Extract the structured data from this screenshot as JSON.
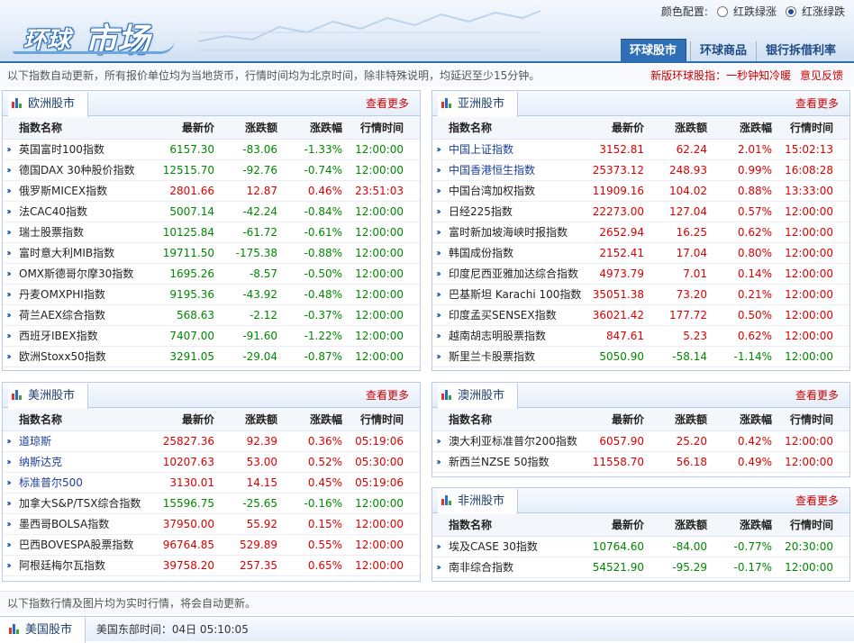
{
  "header": {
    "logo_part1": "环球",
    "logo_part2": "市场",
    "color_config_label": "颜色配置:",
    "option_red_down": "红跌绿涨",
    "option_red_up": "红涨绿跌",
    "tabs": [
      {
        "label": "环球股市",
        "active": true
      },
      {
        "label": "环球商品",
        "active": false
      },
      {
        "label": "银行拆借利率",
        "active": false
      }
    ]
  },
  "notice": {
    "text": "以下指数自动更新，所有报价单位均为当地货币，行情时间均为北京时间，除非特殊说明，均延迟至少15分钟。",
    "link1": "新版环球股指：一秒钟知冷暖",
    "link2": "意见反馈"
  },
  "columns": [
    "指数名称",
    "最新价",
    "涨跌额",
    "涨跌幅",
    "行情时间"
  ],
  "more_label": "查看更多",
  "panels": {
    "europe": {
      "title": "欧洲股市",
      "rows": [
        {
          "name": "英国富时100指数",
          "price": "6157.30",
          "chg": "-83.06",
          "pct": "-1.33%",
          "time": "12:00:00",
          "dir": "dn",
          "style": ""
        },
        {
          "name": "德国DAX 30种股价指数",
          "price": "12515.70",
          "chg": "-92.76",
          "pct": "-0.74%",
          "time": "12:00:00",
          "dir": "dn",
          "style": ""
        },
        {
          "name": "俄罗斯MICEX指数",
          "price": "2801.66",
          "chg": "12.87",
          "pct": "0.46%",
          "time": "23:51:03",
          "dir": "up",
          "style": ""
        },
        {
          "name": "法CAC40指数",
          "price": "5007.14",
          "chg": "-42.24",
          "pct": "-0.84%",
          "time": "12:00:00",
          "dir": "dn",
          "style": ""
        },
        {
          "name": "瑞士股票指数",
          "price": "10125.84",
          "chg": "-61.72",
          "pct": "-0.61%",
          "time": "12:00:00",
          "dir": "dn",
          "style": ""
        },
        {
          "name": "富时意大利MIB指数",
          "price": "19711.50",
          "chg": "-175.38",
          "pct": "-0.88%",
          "time": "12:00:00",
          "dir": "dn",
          "style": ""
        },
        {
          "name": "OMX斯德哥尔摩30指数",
          "price": "1695.26",
          "chg": "-8.57",
          "pct": "-0.50%",
          "time": "12:00:00",
          "dir": "dn",
          "style": ""
        },
        {
          "name": "丹麦OMXPHI指数",
          "price": "9195.36",
          "chg": "-43.92",
          "pct": "-0.48%",
          "time": "12:00:00",
          "dir": "dn",
          "style": ""
        },
        {
          "name": "荷兰AEX综合指数",
          "price": "568.63",
          "chg": "-2.12",
          "pct": "-0.37%",
          "time": "12:00:00",
          "dir": "dn",
          "style": ""
        },
        {
          "name": "西班牙IBEX指数",
          "price": "7407.00",
          "chg": "-91.60",
          "pct": "-1.22%",
          "time": "12:00:00",
          "dir": "dn",
          "style": ""
        },
        {
          "name": "欧洲Stoxx50指数",
          "price": "3291.05",
          "chg": "-29.04",
          "pct": "-0.87%",
          "time": "12:00:00",
          "dir": "dn",
          "style": ""
        }
      ]
    },
    "asia": {
      "title": "亚洲股市",
      "rows": [
        {
          "name": "中国上证指数",
          "price": "3152.81",
          "chg": "62.24",
          "pct": "2.01%",
          "time": "15:02:13",
          "dir": "up",
          "style": "lnk"
        },
        {
          "name": "中国香港恒生指数",
          "price": "25373.12",
          "chg": "248.93",
          "pct": "0.99%",
          "time": "16:08:28",
          "dir": "up",
          "style": "lnk"
        },
        {
          "name": "中国台湾加权指数",
          "price": "11909.16",
          "chg": "104.02",
          "pct": "0.88%",
          "time": "13:33:00",
          "dir": "up",
          "style": ""
        },
        {
          "name": "日经225指数",
          "price": "22273.00",
          "chg": "127.04",
          "pct": "0.57%",
          "time": "12:00:00",
          "dir": "up",
          "style": ""
        },
        {
          "name": "富时新加坡海峡时报指数",
          "price": "2652.94",
          "chg": "16.25",
          "pct": "0.62%",
          "time": "12:00:00",
          "dir": "up",
          "style": ""
        },
        {
          "name": "韩国成份指数",
          "price": "2152.41",
          "chg": "17.04",
          "pct": "0.80%",
          "time": "12:00:00",
          "dir": "up",
          "style": ""
        },
        {
          "name": "印度尼西亚雅加达综合指数",
          "price": "4973.79",
          "chg": "7.01",
          "pct": "0.14%",
          "time": "12:00:00",
          "dir": "up",
          "style": ""
        },
        {
          "name": "巴基斯坦 Karachi 100指数",
          "price": "35051.38",
          "chg": "73.20",
          "pct": "0.21%",
          "time": "12:00:00",
          "dir": "up",
          "style": ""
        },
        {
          "name": "印度孟买SENSEX指数",
          "price": "36021.42",
          "chg": "177.72",
          "pct": "0.50%",
          "time": "12:00:00",
          "dir": "up",
          "style": ""
        },
        {
          "name": "越南胡志明股票指数",
          "price": "847.61",
          "chg": "5.23",
          "pct": "0.62%",
          "time": "12:00:00",
          "dir": "up",
          "style": ""
        },
        {
          "name": "斯里兰卡股票指数",
          "price": "5050.90",
          "chg": "-58.14",
          "pct": "-1.14%",
          "time": "12:00:00",
          "dir": "dn",
          "style": ""
        }
      ]
    },
    "america": {
      "title": "美洲股市",
      "rows": [
        {
          "name": "道琼斯",
          "price": "25827.36",
          "chg": "92.39",
          "pct": "0.36%",
          "time": "05:19:06",
          "dir": "up",
          "style": "lnk"
        },
        {
          "name": "纳斯达克",
          "price": "10207.63",
          "chg": "53.00",
          "pct": "0.52%",
          "time": "05:30:00",
          "dir": "up",
          "style": "lnk"
        },
        {
          "name": "标准普尔500",
          "price": "3130.01",
          "chg": "14.15",
          "pct": "0.45%",
          "time": "05:19:06",
          "dir": "up",
          "style": "lnk"
        },
        {
          "name": "加拿大S&P/TSX综合指数",
          "price": "15596.75",
          "chg": "-25.65",
          "pct": "-0.16%",
          "time": "12:00:00",
          "dir": "dn",
          "style": ""
        },
        {
          "name": "墨西哥BOLSA指数",
          "price": "37950.00",
          "chg": "55.92",
          "pct": "0.15%",
          "time": "12:00:00",
          "dir": "up",
          "style": ""
        },
        {
          "name": "巴西BOVESPA股票指数",
          "price": "96764.85",
          "chg": "529.89",
          "pct": "0.55%",
          "time": "12:00:00",
          "dir": "up",
          "style": ""
        },
        {
          "name": "阿根廷梅尔瓦指数",
          "price": "39758.20",
          "chg": "257.35",
          "pct": "0.65%",
          "time": "12:00:00",
          "dir": "up",
          "style": ""
        }
      ]
    },
    "oceania": {
      "title": "澳洲股市",
      "rows": [
        {
          "name": "澳大利亚标准普尔200指数",
          "price": "6057.90",
          "chg": "25.20",
          "pct": "0.42%",
          "time": "12:00:00",
          "dir": "up",
          "style": ""
        },
        {
          "name": "新西兰NZSE 50指数",
          "price": "11558.70",
          "chg": "56.18",
          "pct": "0.49%",
          "time": "12:00:00",
          "dir": "up",
          "style": ""
        }
      ]
    },
    "africa": {
      "title": "非洲股市",
      "rows": [
        {
          "name": "埃及CASE 30指数",
          "price": "10764.60",
          "chg": "-84.00",
          "pct": "-0.77%",
          "time": "20:30:00",
          "dir": "dn",
          "style": ""
        },
        {
          "name": "南非综合指数",
          "price": "54521.90",
          "chg": "-95.29",
          "pct": "-0.17%",
          "time": "12:00:00",
          "dir": "dn",
          "style": ""
        }
      ]
    }
  },
  "footer_note": "以下指数行情及图片均为实时行情，将会自动更新。",
  "bottom": {
    "title": "美国股市",
    "time_text": "美国东部时间：04日 05:10:05"
  }
}
